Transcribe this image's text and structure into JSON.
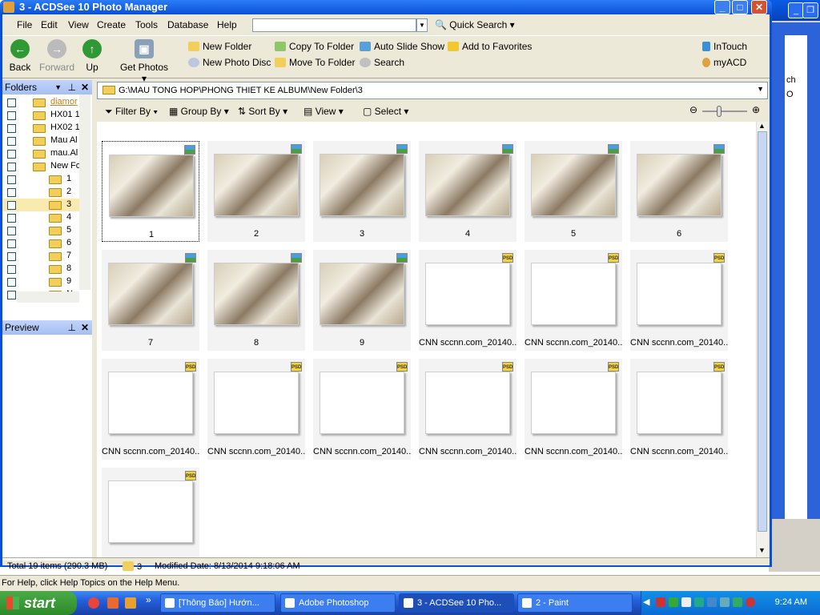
{
  "window": {
    "title": "3 - ACDSee 10 Photo Manager"
  },
  "menu": [
    "File",
    "Edit",
    "View",
    "Create",
    "Tools",
    "Database",
    "Help"
  ],
  "quick_search": {
    "value": "",
    "label": "Quick Search"
  },
  "toolbar": {
    "back": "Back",
    "forward": "Forward",
    "up": "Up",
    "get_photos": "Get Photos",
    "new_folder": "New Folder",
    "new_photo_disc": "New Photo Disc",
    "copy_to_folder": "Copy To Folder",
    "move_to_folder": "Move To Folder",
    "auto_slide_show": "Auto Slide Show",
    "search": "Search",
    "add_to_favorites": "Add to Favorites",
    "intouch": "InTouch",
    "myacd": "myACD"
  },
  "folders_panel": {
    "title": "Folders",
    "items": [
      "diamor",
      "HX01 1",
      "HX02 1",
      "Mau Al",
      "mau.Al",
      "New Fo",
      "1",
      "2",
      "3",
      "4",
      "5",
      "6",
      "7",
      "8",
      "9",
      "New F"
    ]
  },
  "preview_panel": {
    "title": "Preview"
  },
  "path": "G:\\MAU TONG HOP\\PHONG THIET KE ALBUM\\New Folder\\3",
  "filter_bar": {
    "filter_by": "Filter By",
    "group_by": "Group By",
    "sort_by": "Sort By",
    "view": "View",
    "select": "Select"
  },
  "thumbnails": [
    {
      "caption": "1",
      "type": "image"
    },
    {
      "caption": "2",
      "type": "image"
    },
    {
      "caption": "3",
      "type": "image"
    },
    {
      "caption": "4",
      "type": "image"
    },
    {
      "caption": "5",
      "type": "image"
    },
    {
      "caption": "6",
      "type": "image"
    },
    {
      "caption": "7",
      "type": "image"
    },
    {
      "caption": "8",
      "type": "image"
    },
    {
      "caption": "9",
      "type": "image"
    },
    {
      "caption": "CNN sccnn.com_20140...",
      "type": "psd"
    },
    {
      "caption": "CNN sccnn.com_20140...",
      "type": "psd"
    },
    {
      "caption": "CNN sccnn.com_20140...",
      "type": "psd"
    },
    {
      "caption": "CNN sccnn.com_20140...",
      "type": "psd"
    },
    {
      "caption": "CNN sccnn.com_20140...",
      "type": "psd"
    },
    {
      "caption": "CNN sccnn.com_20140...",
      "type": "psd"
    },
    {
      "caption": "CNN sccnn.com_20140...",
      "type": "psd"
    },
    {
      "caption": "CNN sccnn.com_20140...",
      "type": "psd"
    },
    {
      "caption": "CNN sccnn.com_20140...",
      "type": "psd"
    },
    {
      "caption": "",
      "type": "psd"
    }
  ],
  "status": {
    "total": "Total 19 items  (290.3 MB)",
    "folder": "3",
    "modified": "Modified Date: 8/13/2014 9:18:06 AM"
  },
  "help_line": "For Help, click Help Topics on the Help Menu.",
  "taskbar": {
    "start": "start",
    "tasks": [
      "[Thông Báo] Hướn...",
      "Adobe Photoshop",
      "3 - ACDSee 10 Pho...",
      "2 - Paint"
    ],
    "clock": "9:24 AM"
  },
  "background_window": {
    "partial_text": [
      "ch",
      "O"
    ]
  }
}
